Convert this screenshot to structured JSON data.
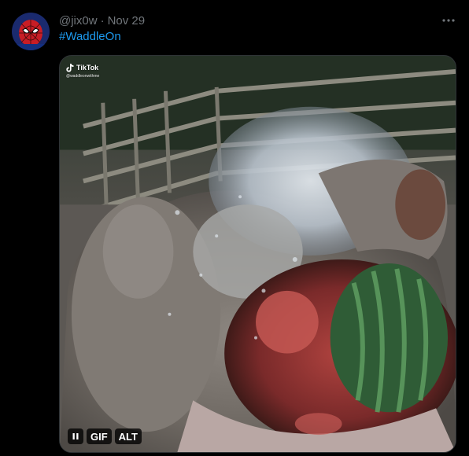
{
  "tweet": {
    "handle": "@jix0w",
    "separator": "·",
    "date": "Nov 29",
    "hashtag": "#WaddleOn",
    "avatar_icon": "spiderman-avatar",
    "more_icon": "more-horizontal-icon"
  },
  "media": {
    "watermark": {
      "brand": "TikTok",
      "handle": "@waddleonwithme"
    },
    "controls": {
      "pause_icon": "pause-icon",
      "gif_label": "GIF",
      "alt_label": "ALT"
    }
  },
  "colors": {
    "background": "#000000",
    "muted_text": "#71767b",
    "link": "#1d9bf0",
    "border": "#2f3336"
  }
}
